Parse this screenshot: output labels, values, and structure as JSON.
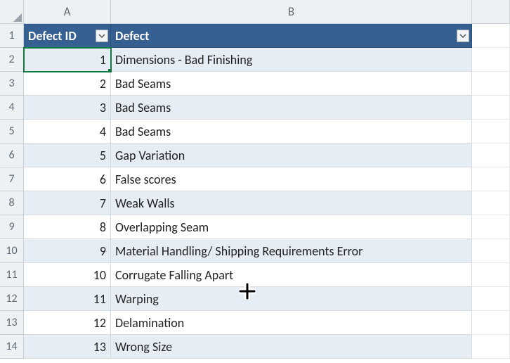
{
  "columns": {
    "A": "A",
    "B": "B"
  },
  "headers": {
    "a": "Defect ID",
    "b": "Defect"
  },
  "rows": [
    {
      "n": "1",
      "id": "1",
      "defect": "Dimensions - Bad Finishing",
      "band": true
    },
    {
      "n": "2",
      "id": "2",
      "defect": "Bad Seams",
      "band": false
    },
    {
      "n": "3",
      "id": "3",
      "defect": "Bad Seams",
      "band": true
    },
    {
      "n": "4",
      "id": "4",
      "defect": "Bad Seams",
      "band": false
    },
    {
      "n": "5",
      "id": "5",
      "defect": "Gap Variation",
      "band": true
    },
    {
      "n": "6",
      "id": "6",
      "defect": "False scores",
      "band": false
    },
    {
      "n": "7",
      "id": "7",
      "defect": "Weak Walls",
      "band": true
    },
    {
      "n": "8",
      "id": "8",
      "defect": "Overlapping Seam",
      "band": false
    },
    {
      "n": "9",
      "id": "9",
      "defect": "Material Handling/ Shipping Requirements Error",
      "band": true
    },
    {
      "n": "10",
      "id": "10",
      "defect": "Corrugate Falling Apart",
      "band": false
    },
    {
      "n": "11",
      "id": "11",
      "defect": "Warping",
      "band": true
    },
    {
      "n": "12",
      "id": "12",
      "defect": "Delamination",
      "band": false
    },
    {
      "n": "13",
      "id": "13",
      "defect": "Wrong Size",
      "band": true
    }
  ],
  "selected_cell": "A2"
}
